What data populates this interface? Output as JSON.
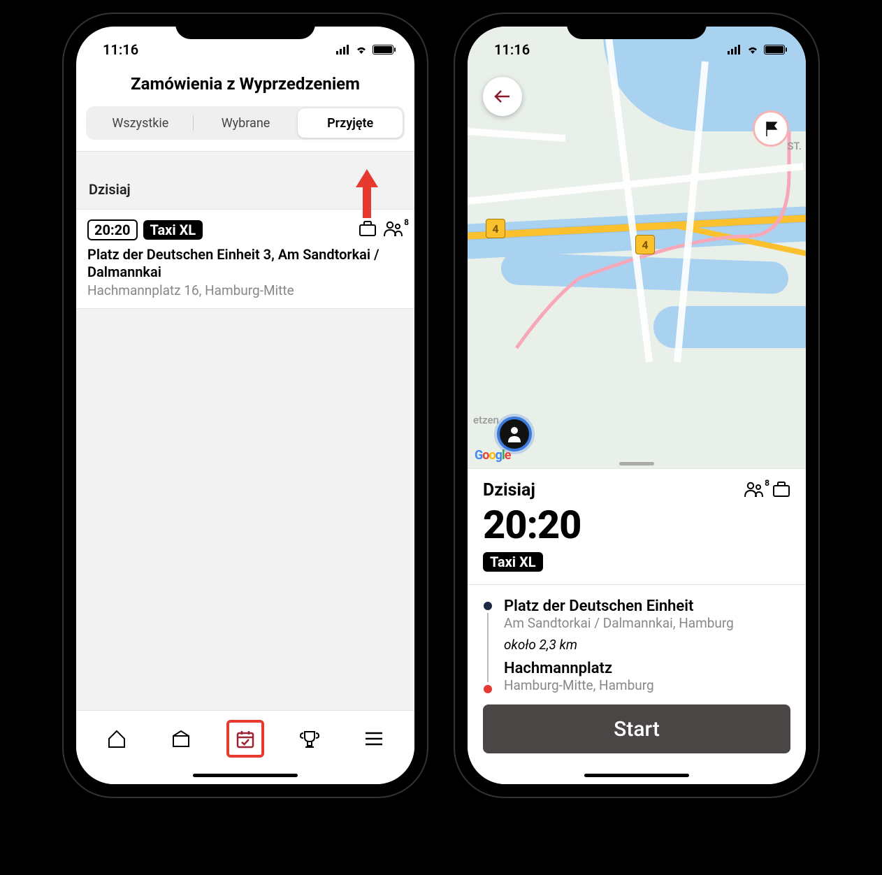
{
  "status": {
    "time": "11:16"
  },
  "left": {
    "title": "Zamówienia z Wyprzedzeniem",
    "tabs": {
      "all": "Wszystkie",
      "selected": "Wybrane",
      "accepted": "Przyjęte"
    },
    "section_label": "Dzisiaj",
    "order": {
      "time": "20:20",
      "type": "Taxi XL",
      "pax": "8",
      "pickup": "Platz der Deutschen Einheit 3, Am Sandtorkai / Dalmannkai",
      "dropoff": "Hachmannplatz 16, Hamburg-Mitte"
    }
  },
  "right": {
    "map": {
      "road_label": "4",
      "place_label": "etzen",
      "st_label": "ST."
    },
    "sheet": {
      "day": "Dzisiaj",
      "time": "20:20",
      "type": "Taxi XL",
      "pax": "8",
      "origin": {
        "name": "Platz der Deutschen Einheit",
        "sub": "Am Sandtorkai / Dalmannkai, Hamburg"
      },
      "distance": "około 2,3 km",
      "destination": {
        "name": "Hachmannplatz",
        "sub": "Hamburg-Mitte, Hamburg"
      },
      "start_label": "Start"
    }
  }
}
